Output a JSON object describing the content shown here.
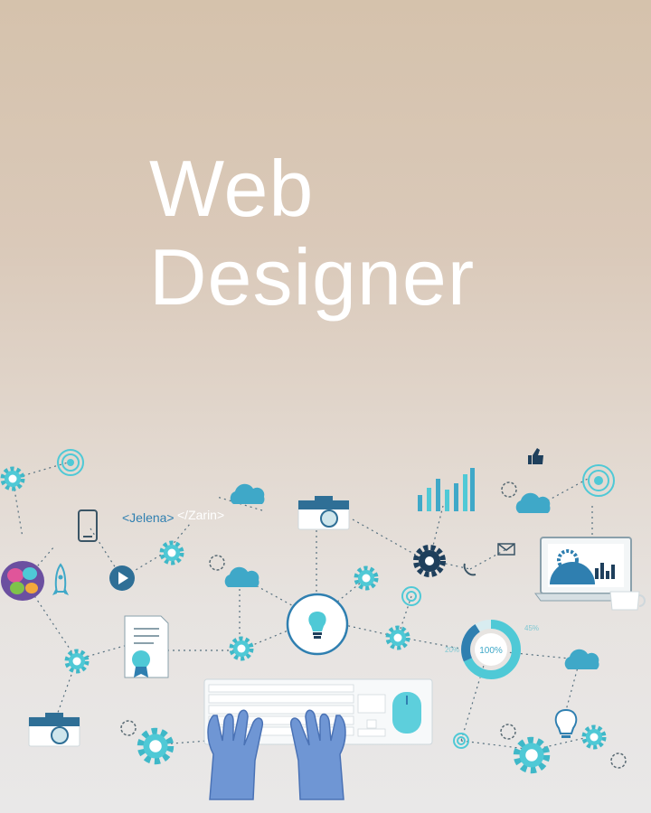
{
  "headline": {
    "line1": "Web",
    "line2": "Designer"
  },
  "illustration": {
    "code_tag_open": "<Jelena>",
    "code_tag_close": "</Zarin>",
    "progress_ring_label": "100%",
    "small_label_1": "45%",
    "small_label_2": "20%"
  },
  "colors": {
    "background_top": "#d5c2ac",
    "background_bottom": "#e9e8e8",
    "accent_cyan": "#4fc9d6",
    "accent_blue": "#2f7fb0",
    "dark_navy": "#1e3f5c",
    "hands": "#6f96d4"
  }
}
